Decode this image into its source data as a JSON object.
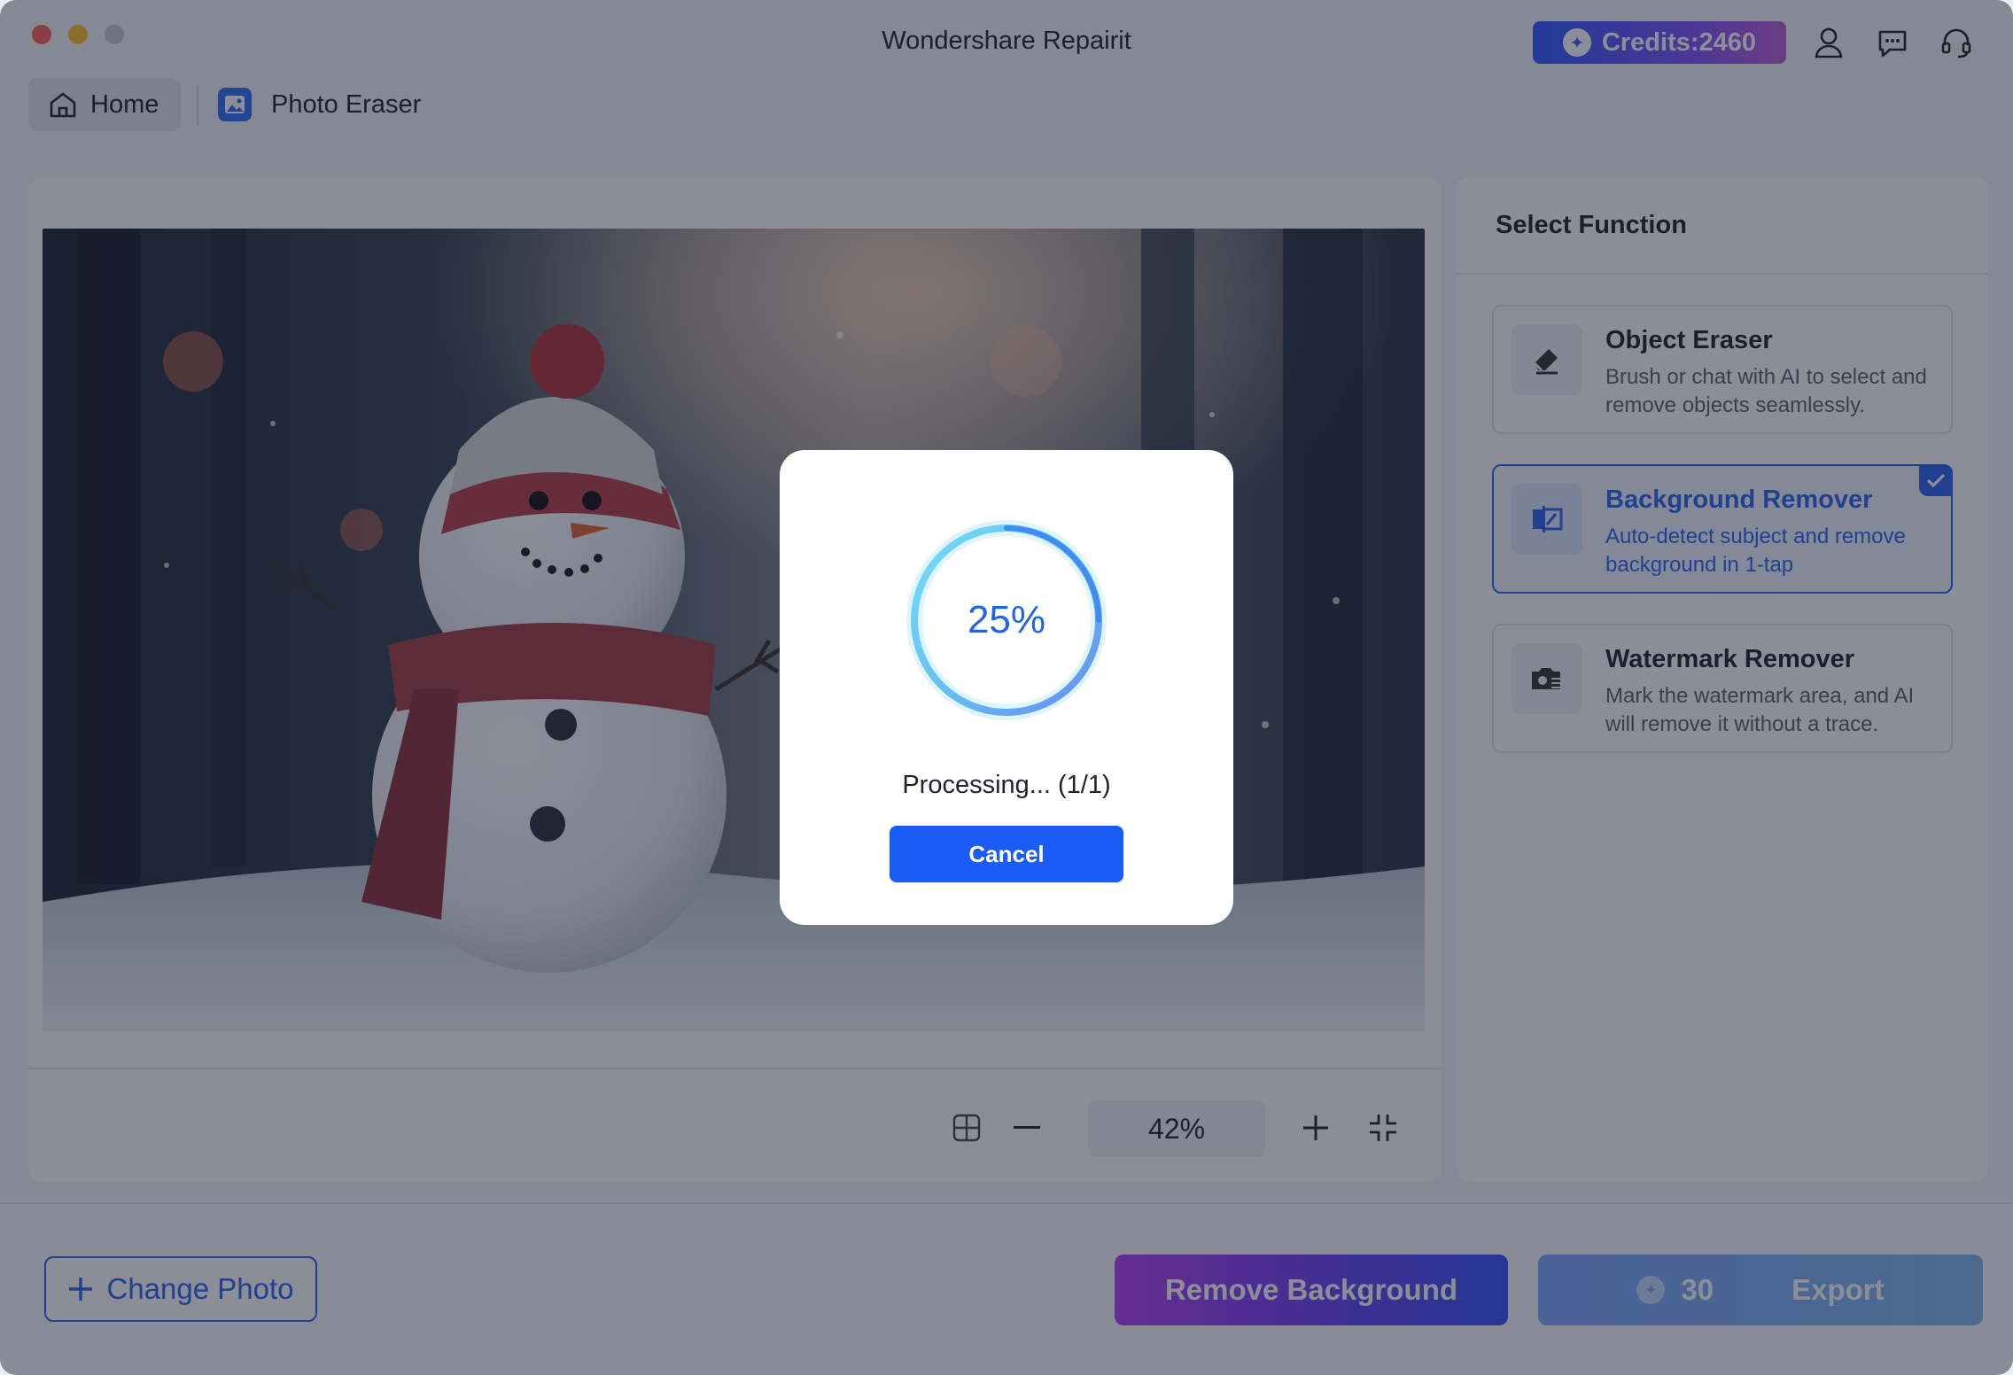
{
  "window": {
    "title": "Wondershare Repairit"
  },
  "credits": {
    "label": "Credits:2460"
  },
  "tabs": {
    "home": "Home",
    "photo_eraser": "Photo Eraser"
  },
  "panel": {
    "title": "Select Function",
    "functions": [
      {
        "name": "Object Eraser",
        "desc": "Brush or chat with AI to select and remove objects seamlessly.",
        "icon": "eraser-icon",
        "selected": false
      },
      {
        "name": "Background Remover",
        "desc": "Auto-detect subject and remove background in 1-tap",
        "icon": "background-remover-icon",
        "selected": true
      },
      {
        "name": "Watermark Remover",
        "desc": "Mark the watermark area, and AI will remove it without a trace.",
        "icon": "watermark-remover-icon",
        "selected": false
      }
    ]
  },
  "zoom": {
    "value": "42%"
  },
  "footer": {
    "change_photo": "Change Photo",
    "remove_background": "Remove Background",
    "export_cost": "30",
    "export_label": "Export"
  },
  "dialog": {
    "progress_label": "25%",
    "progress_fraction": 0.25,
    "status": "Processing... (1/1)",
    "cancel": "Cancel"
  },
  "colors": {
    "accent": "#1a5cf5",
    "selected": "#2a63ee"
  }
}
